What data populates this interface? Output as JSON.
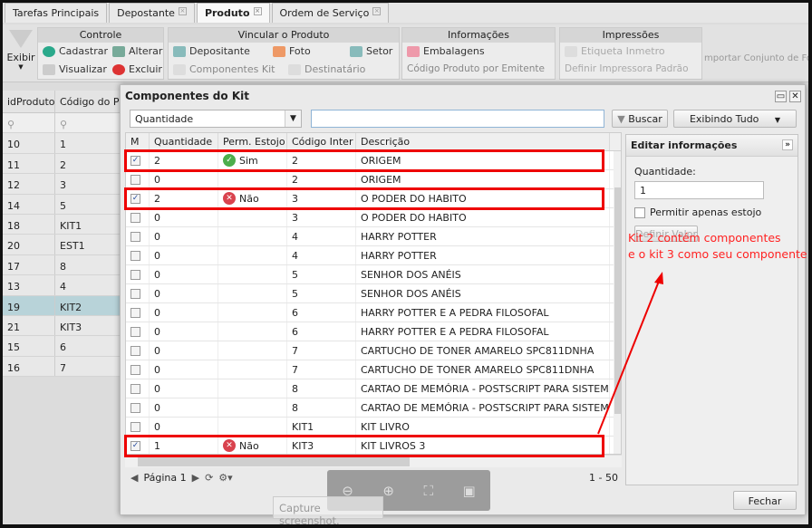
{
  "tabs": [
    {
      "label": "Tarefas Principais"
    },
    {
      "label": "Depostante"
    },
    {
      "label": "Produto"
    },
    {
      "label": "Ordem de Serviço"
    }
  ],
  "ribbon": {
    "exibir": "Exibir",
    "groups": {
      "controle": "Controle",
      "vincular": "Vincular o Produto",
      "informacoes": "Informações",
      "impressoes": "Impressões"
    },
    "items": {
      "cadastrar": "Cadastrar",
      "alterar": "Alterar",
      "visualizar": "Visualizar",
      "excluir": "Excluir",
      "depositante": "Depositante",
      "foto": "Foto",
      "setor": "Setor",
      "componentes_kit": "Componentes Kit",
      "destinatario": "Destinatário",
      "embalagens": "Embalagens",
      "codigo_emitente": "Código Produto por Emitente",
      "etiqueta": "Etiqueta Inmetro",
      "impressora": "Definir Impressora Padrão",
      "importar": "mportar Conjunto de Fot"
    }
  },
  "left_grid": {
    "headers": [
      "idProduto",
      "Código do Prod"
    ],
    "rows": [
      [
        "10",
        "1"
      ],
      [
        "11",
        "2"
      ],
      [
        "12",
        "3"
      ],
      [
        "14",
        "5"
      ],
      [
        "18",
        "KIT1"
      ],
      [
        "20",
        "EST1"
      ],
      [
        "17",
        "8"
      ],
      [
        "13",
        "4"
      ],
      [
        "19",
        "KIT2"
      ],
      [
        "21",
        "KIT3"
      ],
      [
        "15",
        "6"
      ],
      [
        "16",
        "7"
      ]
    ],
    "selected_index": 8
  },
  "dialog": {
    "title": "Componentes do Kit",
    "filter_field": "Quantidade",
    "search_value": "",
    "buscar": "Buscar",
    "exibindo": "Exibindo Tudo",
    "headers": [
      "M",
      "Quantidade",
      "Perm. Estojo",
      "Código Inter",
      "Descrição"
    ],
    "rows": [
      {
        "checked": true,
        "qty": "2",
        "perm": "Sim",
        "code": "2",
        "desc": "ORIGEM"
      },
      {
        "checked": false,
        "qty": "0",
        "perm": "",
        "code": "2",
        "desc": "ORIGEM"
      },
      {
        "checked": true,
        "qty": "2",
        "perm": "Não",
        "code": "3",
        "desc": "O PODER DO HABITO"
      },
      {
        "checked": false,
        "qty": "0",
        "perm": "",
        "code": "3",
        "desc": "O PODER DO HABITO"
      },
      {
        "checked": false,
        "qty": "0",
        "perm": "",
        "code": "4",
        "desc": "HARRY POTTER"
      },
      {
        "checked": false,
        "qty": "0",
        "perm": "",
        "code": "4",
        "desc": "HARRY POTTER"
      },
      {
        "checked": false,
        "qty": "0",
        "perm": "",
        "code": "5",
        "desc": "SENHOR DOS ANÉIS"
      },
      {
        "checked": false,
        "qty": "0",
        "perm": "",
        "code": "5",
        "desc": "SENHOR DOS ANÉIS"
      },
      {
        "checked": false,
        "qty": "0",
        "perm": "",
        "code": "6",
        "desc": "HARRY POTTER E A PEDRA FILOSOFAL"
      },
      {
        "checked": false,
        "qty": "0",
        "perm": "",
        "code": "6",
        "desc": "HARRY POTTER E A PEDRA FILOSOFAL"
      },
      {
        "checked": false,
        "qty": "0",
        "perm": "",
        "code": "7",
        "desc": "CARTUCHO DE TONER AMARELO SPC811DNHA"
      },
      {
        "checked": false,
        "qty": "0",
        "perm": "",
        "code": "7",
        "desc": "CARTUCHO DE TONER AMARELO SPC811DNHA"
      },
      {
        "checked": false,
        "qty": "0",
        "perm": "",
        "code": "8",
        "desc": "CARTAO DE MEMÓRIA - POSTSCRIPT PARA SISTEMA MU..."
      },
      {
        "checked": false,
        "qty": "0",
        "perm": "",
        "code": "8",
        "desc": "CARTAO DE MEMÓRIA - POSTSCRIPT PARA SISTEMA MU..."
      },
      {
        "checked": false,
        "qty": "0",
        "perm": "",
        "code": "KIT1",
        "desc": "KIT LIVRO"
      },
      {
        "checked": true,
        "qty": "1",
        "perm": "Não",
        "code": "KIT3",
        "desc": "KIT LIVROS 3"
      }
    ],
    "pager": {
      "page": "Página 1",
      "range": "1 - 50"
    },
    "edit": {
      "title": "Editar informações",
      "qty_label": "Quantidade:",
      "qty_value": "1",
      "checkbox_label": "Permitir apenas estojo",
      "define": "Definir Valor"
    },
    "close": "Fechar"
  },
  "annotation": {
    "line1": "Kit 2 contém componentes",
    "line2": "e o kit 3 como seu componente"
  },
  "tooltip": "Capture screenshot.",
  "colors": {
    "highlight": "#e00000",
    "sim": "#4cae4c",
    "nao": "#d9434e",
    "selected_row": "#b8d3d9"
  }
}
